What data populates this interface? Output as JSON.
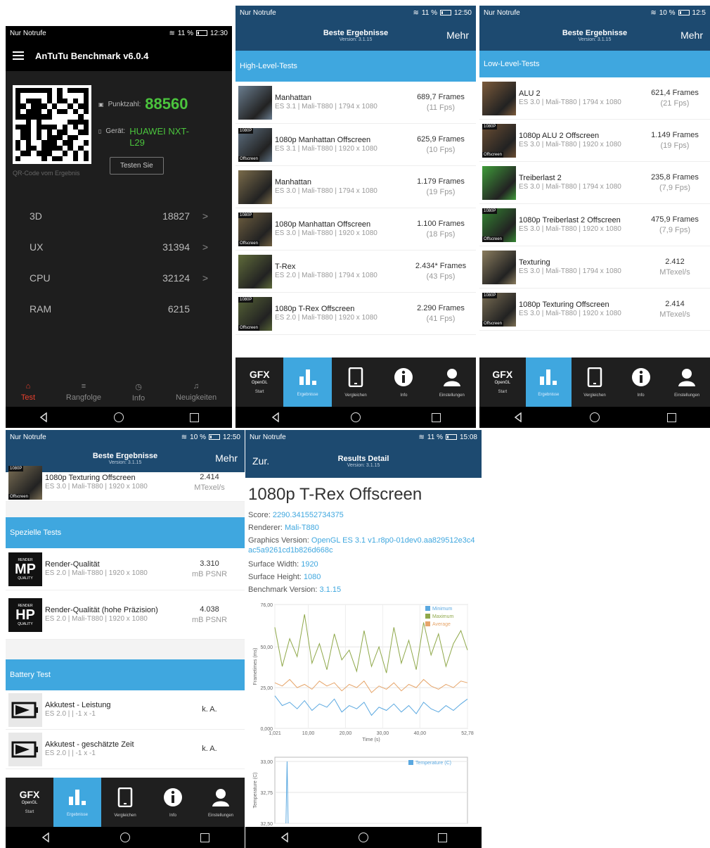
{
  "status": {
    "carrier": "Nur Notrufe",
    "p1": {
      "battery": "11 %",
      "time": "12:30"
    },
    "p2": {
      "battery": "11 %",
      "time": "12:50"
    },
    "p3": {
      "battery": "10 %",
      "time": "12:5"
    },
    "p4": {
      "battery": "10 %",
      "time": "12:50"
    },
    "p5": {
      "battery": "11 %",
      "time": "15:08"
    }
  },
  "antutu": {
    "title": "AnTuTu Benchmark v6.0.4",
    "score_label": "Punktzahl:",
    "score": "88560",
    "device_label": "Gerät:",
    "device": "HUAWEI NXT-L29",
    "qr_caption": "QR-Code vom Ergebnis",
    "test_button": "Testen Sie",
    "rows": [
      {
        "label": "3D",
        "value": "18827",
        "chevron": ">"
      },
      {
        "label": "UX",
        "value": "31394",
        "chevron": ">"
      },
      {
        "label": "CPU",
        "value": "32124",
        "chevron": ">"
      },
      {
        "label": "RAM",
        "value": "6215",
        "chevron": ""
      }
    ],
    "tabs": [
      {
        "label": "Test",
        "icon": "home-icon",
        "glyph": "⌂"
      },
      {
        "label": "Rangfolge",
        "icon": "list-icon",
        "glyph": "≡"
      },
      {
        "label": "Info",
        "icon": "info-icon",
        "glyph": "◷"
      },
      {
        "label": "Neuigkeiten",
        "icon": "bell-icon",
        "glyph": "♫"
      }
    ],
    "accent": "#4bc43d",
    "active_tab_color": "#e8402d"
  },
  "gfx": {
    "header_title": "Beste Ergebnisse",
    "header_version": "Version: 3.1.15",
    "more": "Mehr",
    "tabs": [
      {
        "label": "Start",
        "icon": "gfx-logo-icon"
      },
      {
        "label": "Ergebnisse",
        "icon": "bar-chart-icon"
      },
      {
        "label": "Vergleichen",
        "icon": "phone-icon"
      },
      {
        "label": "Info",
        "icon": "info-icon"
      },
      {
        "label": "Einstellungen",
        "icon": "person-icon"
      }
    ],
    "gfx_logo": "GFX",
    "gfx_logo_sub": "OpenGL",
    "accent": "#3fa7df",
    "header_color": "#1d4a70"
  },
  "high_level": {
    "section": "High-Level-Tests",
    "tests": [
      {
        "name": "Manhattan",
        "sub": "ES 3.1 | Mali-T880 | 1794 x 1080",
        "result": "689,7 Frames",
        "fps": "(11 Fps)",
        "tag": "",
        "tag2": "",
        "thumb": "#6a7d8f"
      },
      {
        "name": "1080p Manhattan Offscreen",
        "sub": "ES 3.1 | Mali-T880 | 1920 x 1080",
        "result": "625,9 Frames",
        "fps": "(10 Fps)",
        "tag": "1080P",
        "tag2": "Offscreen",
        "thumb": "#5d6f80"
      },
      {
        "name": "Manhattan",
        "sub": "ES 3.0 | Mali-T880 | 1794 x 1080",
        "result": "1.179 Frames",
        "fps": "(19 Fps)",
        "tag": "",
        "tag2": "",
        "thumb": "#7a6b4a"
      },
      {
        "name": "1080p Manhattan Offscreen",
        "sub": "ES 3.0 | Mali-T880 | 1920 x 1080",
        "result": "1.100 Frames",
        "fps": "(18 Fps)",
        "tag": "1080P",
        "tag2": "Offscreen",
        "thumb": "#6f5f40"
      },
      {
        "name": "T-Rex",
        "sub": "ES 2.0 | Mali-T880 | 1794 x 1080",
        "result": "2.434* Frames",
        "fps": "(43 Fps)",
        "tag": "",
        "tag2": "",
        "thumb": "#5f6b3a"
      },
      {
        "name": "1080p T-Rex Offscreen",
        "sub": "ES 2.0 | Mali-T880 | 1920 x 1080",
        "result": "2.290 Frames",
        "fps": "(41 Fps)",
        "tag": "1080P",
        "tag2": "Offscreen",
        "thumb": "#566336"
      }
    ]
  },
  "low_level": {
    "section": "Low-Level-Tests",
    "tests": [
      {
        "name": "ALU 2",
        "sub": "ES 3.0 | Mali-T880 | 1794 x 1080",
        "result": "621,4 Frames",
        "fps": "(21 Fps)",
        "tag": "",
        "tag2": "",
        "thumb": "#7b5a3a"
      },
      {
        "name": "1080p ALU 2 Offscreen",
        "sub": "ES 3.0 | Mali-T880 | 1920 x 1080",
        "result": "1.149 Frames",
        "fps": "(19 Fps)",
        "tag": "1080P",
        "tag2": "Offscreen",
        "thumb": "#6b4e33"
      },
      {
        "name": "Treiberlast 2",
        "sub": "ES 3.0 | Mali-T880 | 1794 x 1080",
        "result": "235,8 Frames",
        "fps": "(7,9 Fps)",
        "tag": "",
        "tag2": "",
        "thumb": "#3f9b3a"
      },
      {
        "name": "1080p Treiberlast 2 Offscreen",
        "sub": "ES 3.0 | Mali-T880 | 1920 x 1080",
        "result": "475,9 Frames",
        "fps": "(7,9 Fps)",
        "tag": "1080P",
        "tag2": "Offscreen",
        "thumb": "#348632"
      },
      {
        "name": "Texturing",
        "sub": "ES 3.0 | Mali-T880 | 1794 x 1080",
        "result": "2.412",
        "fps": "MTexel/s",
        "tag": "",
        "tag2": "",
        "thumb": "#8a7c5e"
      },
      {
        "name": "1080p Texturing Offscreen",
        "sub": "ES 3.0 | Mali-T880 | 1920 x 1080",
        "result": "2.414",
        "fps": "MTexel/s",
        "tag": "1080P",
        "tag2": "Offscreen",
        "thumb": "#7a6e54"
      }
    ]
  },
  "special": {
    "top_row": {
      "name": "1080p Texturing Offscreen",
      "sub": "ES 3.0 | Mali-T880 | 1920 x 1080",
      "result": "2.414",
      "fps": "MTexel/s",
      "tag": "1080P",
      "tag2": "Offscreen",
      "thumb": "#7a6e54"
    },
    "section": "Spezielle Tests",
    "tests": [
      {
        "name": "Render-Qualität",
        "sub": "ES 2.0 | Mali-T880 | 1920 x 1080",
        "result": "3.310",
        "fps": "mB PSNR",
        "badge": "MP",
        "badge_top": "RENDER",
        "badge_bottom": "QUALITY"
      },
      {
        "name": "Render-Qualität (hohe Präzision)",
        "sub": "ES 2.0 | Mali-T880 | 1920 x 1080",
        "result": "4.038",
        "fps": "mB PSNR",
        "badge": "HP",
        "badge_top": "RENDER",
        "badge_bottom": "QUALITY"
      }
    ],
    "battery_section": "Battery Test",
    "battery": [
      {
        "name": "Akkutest - Leistung",
        "sub": "ES 2.0 | | -1 x -1",
        "result": "k. A."
      },
      {
        "name": "Akkutest - geschätzte Zeit",
        "sub": "ES 2.0 | | -1 x -1",
        "result": "k. A."
      }
    ]
  },
  "detail": {
    "back": "Zur.",
    "header_title": "Results Detail",
    "header_version": "Version: 3.1.15",
    "title": "1080p T-Rex Offscreen",
    "fields": [
      {
        "label": "Score:",
        "value": "2290.341552734375"
      },
      {
        "label": "Renderer:",
        "value": "Mali-T880"
      },
      {
        "label": "Graphics Version:",
        "value": "OpenGL ES 3.1 v1.r8p0-01dev0.aa829512e3c4ac5a9261cd1b826d668c"
      },
      {
        "label": "Surface Width:",
        "value": "1920"
      },
      {
        "label": "Surface Height:",
        "value": "1080"
      },
      {
        "label": "Benchmark Version:",
        "value": "3.1.15"
      }
    ]
  },
  "chart_data": [
    {
      "type": "line",
      "ylabel": "Frametimes (ms)",
      "xlabel": "Time (s)",
      "ylim": [
        0,
        76
      ],
      "xlim": [
        1.021,
        52.78
      ],
      "yticks": [
        "0,000",
        "25,00",
        "50,00",
        "76,00"
      ],
      "xticks": [
        "1,021",
        "10,00",
        "20,00",
        "30,00",
        "40,00",
        "52,78"
      ],
      "legend": "top-right",
      "x": [
        1,
        3,
        5,
        7,
        9,
        11,
        13,
        15,
        17,
        19,
        21,
        23,
        25,
        27,
        29,
        31,
        33,
        35,
        37,
        39,
        41,
        43,
        45,
        47,
        49,
        51,
        52.78
      ],
      "series": [
        {
          "name": "Minimum",
          "color": "#5aa8e0",
          "values": [
            20,
            14,
            16,
            12,
            17,
            11,
            15,
            13,
            18,
            10,
            14,
            12,
            16,
            8,
            13,
            11,
            15,
            10,
            14,
            9,
            16,
            12,
            10,
            14,
            11,
            15,
            18
          ]
        },
        {
          "name": "Maximum",
          "color": "#8fa84a",
          "values": [
            62,
            38,
            55,
            44,
            70,
            40,
            52,
            36,
            58,
            42,
            48,
            35,
            60,
            38,
            50,
            34,
            62,
            40,
            54,
            36,
            65,
            45,
            58,
            38,
            52,
            60,
            48
          ]
        },
        {
          "name": "Average",
          "color": "#e6a56a",
          "values": [
            28,
            26,
            30,
            25,
            27,
            24,
            29,
            26,
            28,
            23,
            27,
            25,
            29,
            22,
            26,
            24,
            28,
            23,
            27,
            25,
            30,
            26,
            24,
            27,
            25,
            29,
            28
          ]
        }
      ]
    },
    {
      "type": "line",
      "ylabel": "Temperature (C)",
      "yticks": [
        "32,50",
        "32,75",
        "33,00"
      ],
      "ylim": [
        32.5,
        33.0
      ],
      "legend": "top-right",
      "x": [
        4,
        4.3,
        4.6
      ],
      "series": [
        {
          "name": "Temperature (C)",
          "color": "#5aa8e0",
          "values": [
            32.5,
            33.0,
            32.5
          ]
        }
      ]
    }
  ]
}
